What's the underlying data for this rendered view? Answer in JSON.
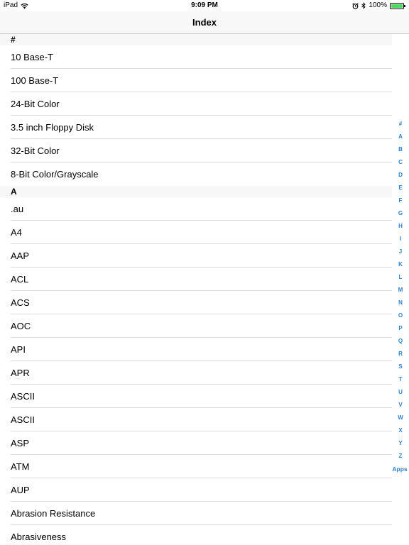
{
  "status_bar": {
    "device": "iPad",
    "time": "9:09 PM",
    "battery_text": "100%",
    "battery_level": 1.0,
    "icons": [
      "wifi-icon",
      "alarm-icon",
      "bluetooth-icon",
      "battery-icon"
    ]
  },
  "nav": {
    "title": "Index"
  },
  "colors": {
    "index_accent": "#2f80c8",
    "battery_fill": "#4cd964",
    "section_bg": "#f7f7f7",
    "separator": "#dcdcdf"
  },
  "sections": [
    {
      "header": "#",
      "items": [
        "10 Base-T",
        "100 Base-T",
        "24-Bit Color",
        "3.5 inch Floppy Disk",
        "32-Bit Color",
        "8-Bit Color/Grayscale"
      ]
    },
    {
      "header": "A",
      "items": [
        ".au",
        "A4",
        "AAP",
        "ACL",
        "ACS",
        "AOC",
        "API",
        "APR",
        "ASCII",
        "ASCII",
        "ASP",
        "ATM",
        "AUP",
        "Abrasion Resistance",
        "Abrasiveness"
      ]
    }
  ],
  "index_letters": [
    "#",
    "A",
    "B",
    "C",
    "D",
    "E",
    "F",
    "G",
    "H",
    "I",
    "J",
    "K",
    "L",
    "M",
    "N",
    "O",
    "P",
    "Q",
    "R",
    "S",
    "T",
    "U",
    "V",
    "W",
    "X",
    "Y",
    "Z",
    "Apps"
  ]
}
